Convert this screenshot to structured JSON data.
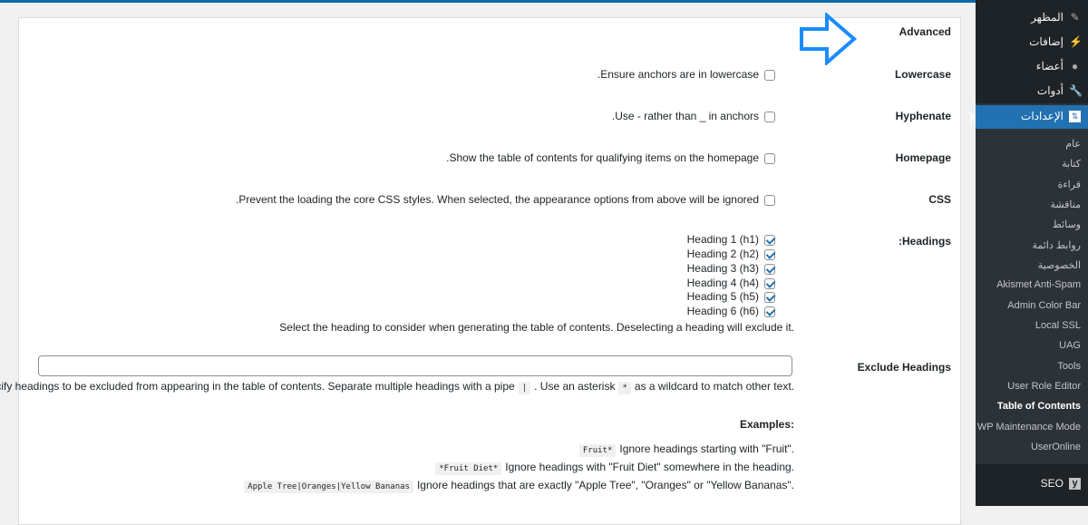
{
  "sidebar": {
    "menu": [
      {
        "label": "المظهر",
        "icon": "paintbrush-icon"
      },
      {
        "label": "إضافات",
        "icon": "plugin-icon"
      },
      {
        "label": "أعضاء",
        "icon": "user-icon"
      },
      {
        "label": "أدوات",
        "icon": "wrench-icon"
      }
    ],
    "active": {
      "label": "الإعدادات",
      "icon": "settings-icon"
    },
    "submenu": [
      "عام",
      "كتابة",
      "قراءة",
      "مناقشة",
      "وسائط",
      "روابط دائمة",
      "الخصوصية",
      "Akismet Anti-Spam",
      "Admin Color Bar",
      "Local SSL",
      "UAG",
      "Tools",
      "User Role Editor",
      "Table of Contents",
      "WP Maintenance Mode",
      "UserOnline"
    ],
    "current_submenu": "Table of Contents",
    "seo": {
      "label": "SEO",
      "icon": "yoast-icon"
    }
  },
  "settings": {
    "section": "Advanced",
    "lowercase": {
      "label": "Lowercase",
      "text": "Ensure anchors are in lowercase.",
      "checked": false
    },
    "hyphenate": {
      "label": "Hyphenate",
      "text": "Use - rather than _ in anchors.",
      "checked": false
    },
    "homepage": {
      "label": "Homepage",
      "text": "Show the table of contents for qualifying items on the homepage.",
      "checked": false
    },
    "css": {
      "label": "CSS",
      "text": "Prevent the loading the core CSS styles. When selected, the appearance options from above will be ignored.",
      "checked": false
    },
    "headings": {
      "label": "Headings:",
      "items": [
        {
          "label": "Heading 1 (h1)",
          "checked": true
        },
        {
          "label": "Heading 2 (h2)",
          "checked": true
        },
        {
          "label": "Heading 3 (h3)",
          "checked": true
        },
        {
          "label": "Heading 4 (h4)",
          "checked": true
        },
        {
          "label": "Heading 5 (h5)",
          "checked": true
        },
        {
          "label": "Heading 6 (h6)",
          "checked": true
        }
      ],
      "description": "Select the heading to consider when generating the table of contents. Deselecting a heading will exclude it."
    },
    "exclude": {
      "label": "Exclude Headings",
      "value": "",
      "help_1": "Specify headings to be excluded from appearing in the table of contents. Separate multiple headings with a pipe",
      "pipe": "|",
      "help_2": ". Use an asterisk",
      "asterisk": "*",
      "help_3": "as a wildcard to match other text."
    },
    "examples": {
      "title": "Examples:",
      "items": [
        {
          "code": "Fruit*",
          "text": "Ignore headings starting with \"Fruit\"."
        },
        {
          "code": "*Fruit Diet*",
          "text": "Ignore headings with \"Fruit Diet\" somewhere in the heading."
        },
        {
          "code": "Apple Tree|Oranges|Yellow Bananas",
          "text": "Ignore headings that are exactly \"Apple Tree\", \"Oranges\" or \"Yellow Bananas\"."
        }
      ]
    }
  },
  "colors": {
    "accent": "#2271b1",
    "arrow": "#1a8cff",
    "sidebar": "#2c3338"
  }
}
